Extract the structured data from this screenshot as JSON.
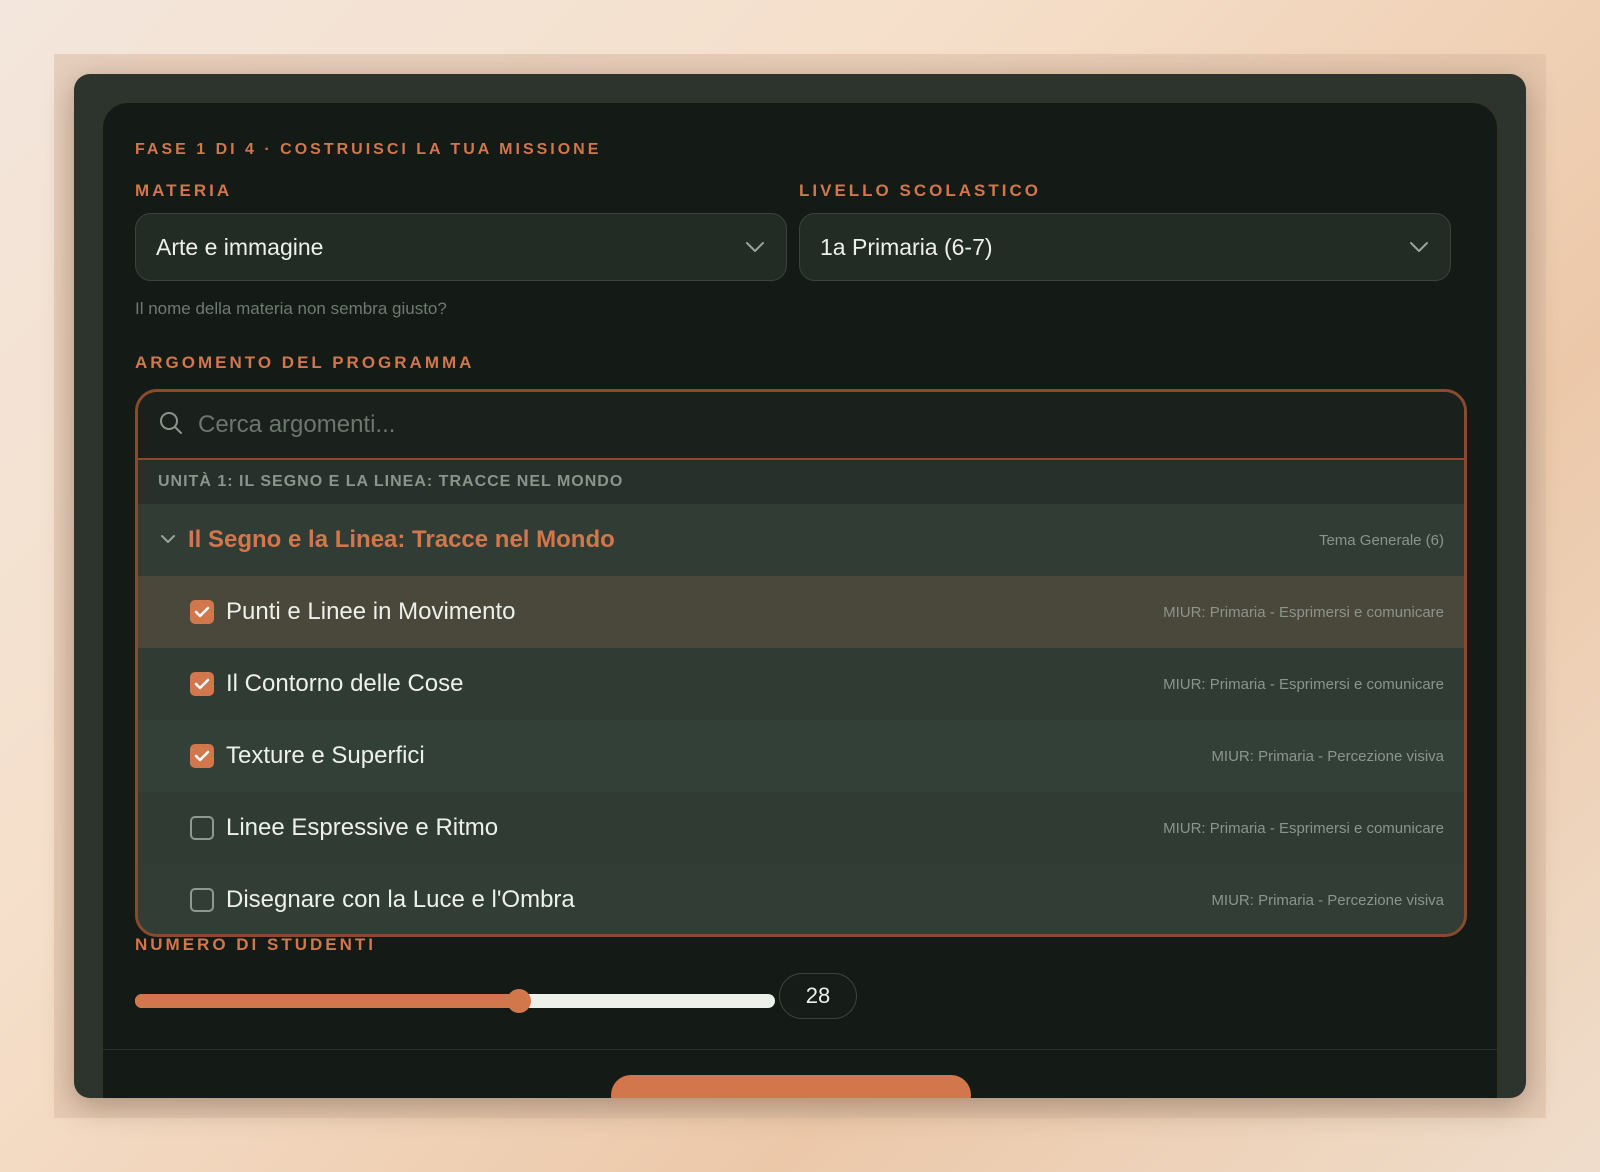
{
  "step": "FASE 1 DI 4 · COSTRUISCI LA TUA MISSIONE",
  "subject": {
    "label": "MATERIA",
    "value": "Arte e immagine",
    "hint": "Il nome della materia non sembra giusto?"
  },
  "level": {
    "label": "LIVELLO SCOLASTICO",
    "value": "1a Primaria (6-7)"
  },
  "topics": {
    "label": "ARGOMENTO DEL PROGRAMMA",
    "search_placeholder": "Cerca argomenti...",
    "unit": "UNITÀ 1: IL SEGNO E LA LINEA: TRACCE NEL MONDO",
    "group": {
      "title": "Il Segno e la Linea: Tracce nel Mondo",
      "meta": "Tema Generale (6)"
    },
    "items": [
      {
        "title": "Punti e Linee in Movimento",
        "meta": "MIUR: Primaria - Esprimersi e comunicare",
        "checked": true
      },
      {
        "title": "Il Contorno delle Cose",
        "meta": "MIUR: Primaria - Esprimersi e comunicare",
        "checked": true
      },
      {
        "title": "Texture e Superfici",
        "meta": "MIUR: Primaria - Percezione visiva",
        "checked": true
      },
      {
        "title": "Linee Espressive e Ritmo",
        "meta": "MIUR: Primaria - Esprimersi e comunicare",
        "checked": false
      },
      {
        "title": "Disegnare con la Luce e l'Ombra",
        "meta": "MIUR: Primaria - Percezione visiva",
        "checked": false
      }
    ]
  },
  "students": {
    "label": "NUMERO DI STUDENTI",
    "value": "28",
    "fill_fraction": 0.6
  },
  "colors": {
    "accent": "#d2764c",
    "card": "#141a16",
    "frame": "#2c342d"
  },
  "icons": {
    "search": "search-icon",
    "dropdown": "chevron-down-icon",
    "check": "checkmark-icon"
  }
}
